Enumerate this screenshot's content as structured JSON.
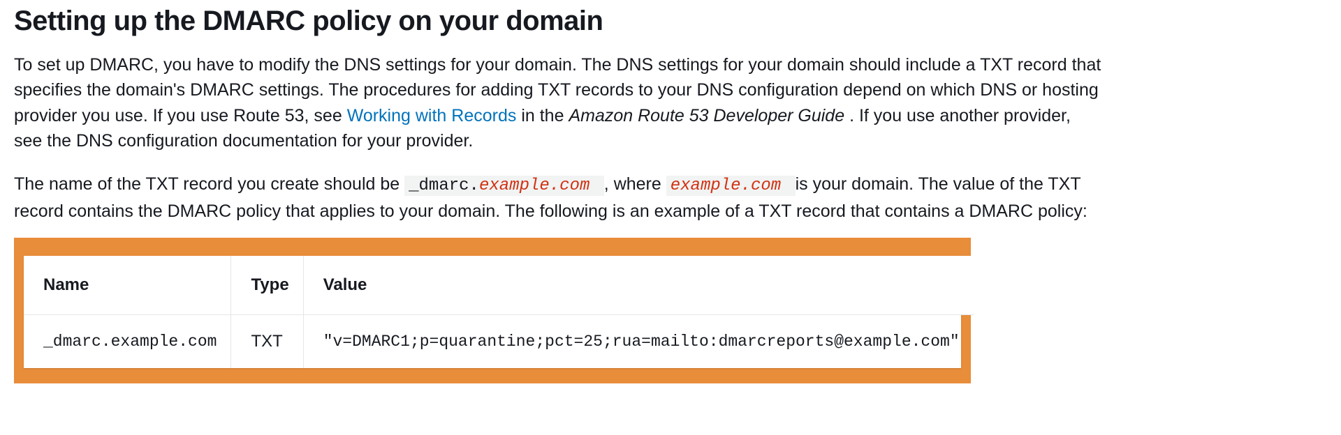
{
  "heading": "Setting up the DMARC policy on your domain",
  "para1": {
    "t1": "To set up DMARC, you have to modify the DNS settings for your domain. The DNS settings for your domain should include a TXT record that specifies the domain's DMARC settings. The procedures for adding TXT records to your DNS configuration depend on which DNS or hosting provider you use. If you use Route 53, see ",
    "link": "Working with Records",
    "t2": " in the ",
    "book": "Amazon Route 53 Developer Guide",
    "t3": ". If you use another provider, see the DNS configuration documentation for your provider."
  },
  "para2": {
    "t1": "The name of the TXT record you create should be ",
    "code1_prefix": "_dmarc.",
    "code1_repl": "example.com",
    "t2": ", where ",
    "code2_repl": "example.com",
    "t3": " is your domain. The value of the TXT record contains the DMARC policy that applies to your domain. The following is an example of a TXT record that contains a DMARC policy:"
  },
  "table": {
    "headers": {
      "name": "Name",
      "type": "Type",
      "value": "Value"
    },
    "rows": [
      {
        "name": "_dmarc.example.com",
        "type": "TXT",
        "value": "\"v=DMARC1;p=quarantine;pct=25;rua=mailto:dmarcreports@example.com\""
      }
    ]
  }
}
